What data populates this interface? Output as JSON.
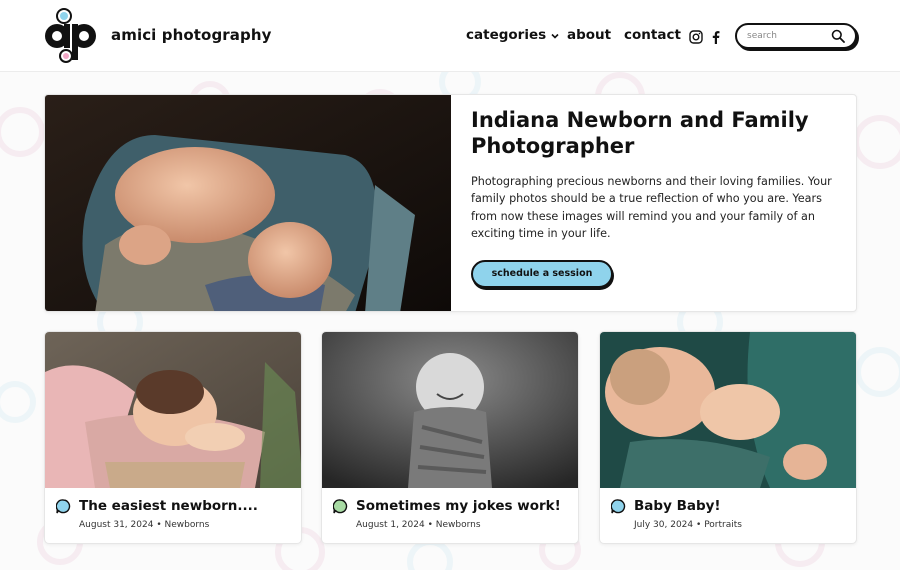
{
  "brand": {
    "name": "amici photography",
    "logo_letters": "ap"
  },
  "nav": {
    "items": [
      {
        "label": "categories",
        "has_dropdown": true
      },
      {
        "label": "about"
      },
      {
        "label": "contact"
      }
    ],
    "social": [
      "instagram-icon",
      "facebook-icon"
    ]
  },
  "search": {
    "placeholder": "search",
    "value": ""
  },
  "hero": {
    "title": "Indiana Newborn and Family Photographer",
    "text": "Photographing precious newborns and their loving families. Your family photos should be a true reflection of who you are. Years from now these images will remind you and your family of an exciting time in your life.",
    "cta_label": "schedule a session"
  },
  "posts": [
    {
      "title": "The easiest newborn....",
      "date": "August 31, 2024",
      "category": "Newborns",
      "bubble_color": "#8fd3ec"
    },
    {
      "title": "Sometimes my jokes work!",
      "date": "August 1, 2024",
      "category": "Newborns",
      "bubble_color": "#a8dba4"
    },
    {
      "title": "Baby Baby!",
      "date": "July 30, 2024",
      "category": "Portraits",
      "bubble_color": "#8fd3ec"
    }
  ],
  "colors": {
    "accent_blue": "#8fd3ec",
    "accent_green": "#a8dba4",
    "accent_pink": "#f2a7c6",
    "ink": "#111111"
  }
}
